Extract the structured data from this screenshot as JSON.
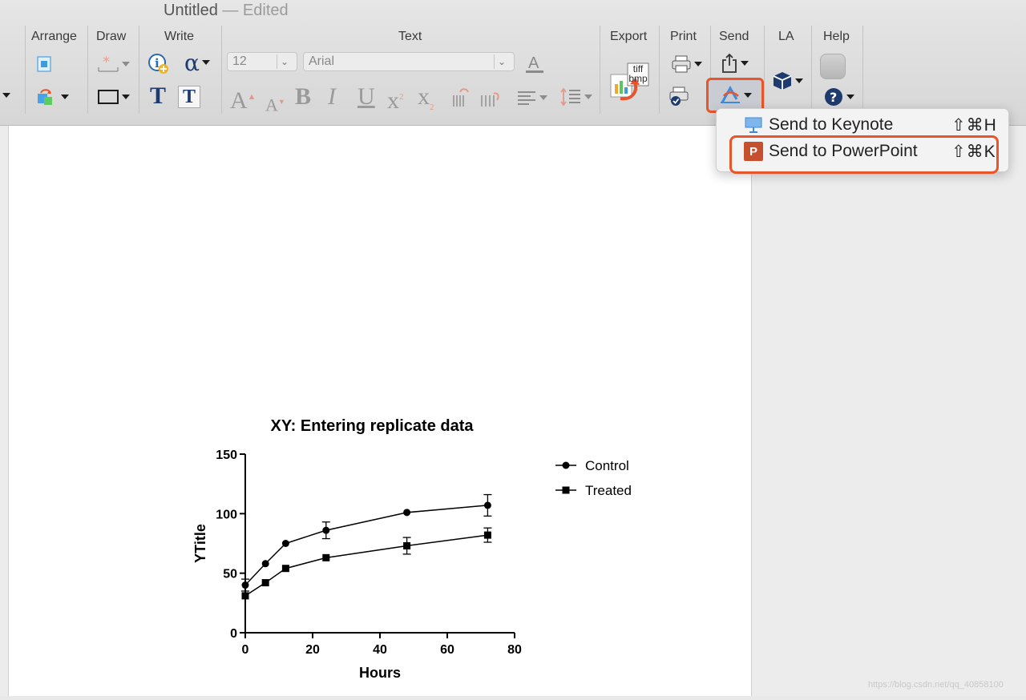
{
  "window": {
    "title": "Untitled",
    "title_suffix": "— Edited"
  },
  "toolbar": {
    "groups": {
      "arrange": "Arrange",
      "draw": "Draw",
      "write": "Write",
      "text": "Text",
      "export": "Export",
      "print": "Print",
      "send": "Send",
      "la": "LA",
      "help": "Help"
    },
    "font_size": "12",
    "font_name": "Arial",
    "write_alpha": "α",
    "write_T": "T",
    "export_badge_top": "tiff",
    "export_badge_bottom": "bmp",
    "text_format": {
      "bigger": "A",
      "smaller": "A",
      "bold": "B",
      "italic": "I",
      "underline": "U",
      "superscript": "x",
      "sup_mark": "2",
      "subscript": "x",
      "sub_mark": "2"
    }
  },
  "send_menu": {
    "items": [
      {
        "label": "Send to Keynote",
        "shortcut": "⇧⌘H",
        "icon": "keynote-icon"
      },
      {
        "label": "Send to PowerPoint",
        "shortcut": "⇧⌘K",
        "icon": "powerpoint-icon",
        "icon_letter": "P"
      }
    ]
  },
  "colors": {
    "accent_highlight": "#e8552a",
    "powerpoint": "#c6502d",
    "keynote": "#3d8bdc"
  },
  "chart_data": {
    "type": "line",
    "title": "XY: Entering replicate data",
    "xlabel": "Hours",
    "ylabel": "YTitle",
    "xlim": [
      0,
      80
    ],
    "ylim": [
      0,
      150
    ],
    "xticks": [
      0,
      20,
      40,
      60,
      80
    ],
    "yticks": [
      0,
      50,
      100,
      150
    ],
    "legend_position": "right",
    "series": [
      {
        "name": "Control",
        "marker": "circle",
        "x": [
          0,
          6,
          12,
          24,
          48,
          72
        ],
        "y": [
          40,
          58,
          75,
          86,
          101,
          107
        ],
        "err": [
          5,
          0,
          0,
          7,
          0,
          9
        ]
      },
      {
        "name": "Treated",
        "marker": "square",
        "x": [
          0,
          6,
          12,
          24,
          48,
          72
        ],
        "y": [
          31,
          42,
          54,
          63,
          73,
          82
        ],
        "err": [
          0,
          0,
          0,
          0,
          7,
          6
        ]
      }
    ]
  },
  "watermark": "https://blog.csdn.net/qq_40858100"
}
